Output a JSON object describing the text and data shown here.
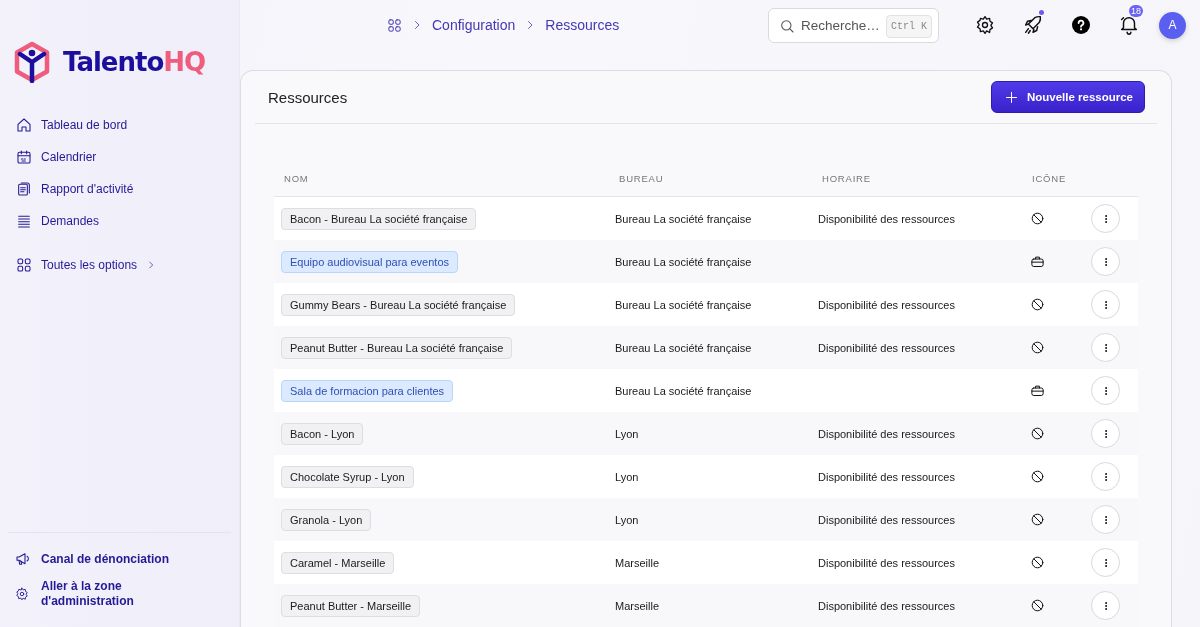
{
  "logo": {
    "text": "Talento",
    "accent": "HQ"
  },
  "sidebar": {
    "items": [
      {
        "label": "Tableau de bord"
      },
      {
        "label": "Calendrier"
      },
      {
        "label": "Rapport d'activité"
      },
      {
        "label": "Demandes"
      }
    ],
    "all_options": "Toutes les options",
    "footer": [
      {
        "label": "Canal de dénonciation"
      },
      {
        "label": "Aller à la zone d'administration"
      }
    ]
  },
  "breadcrumb": [
    "Configuration",
    "Ressources"
  ],
  "search": {
    "placeholder": "Recherche…",
    "shortcut": "Ctrl K"
  },
  "rocket": {
    "unread": true
  },
  "notifications": {
    "count": "18"
  },
  "avatar": "A",
  "page": {
    "title": "Ressources",
    "new_button": "Nouvelle ressource"
  },
  "table": {
    "columns": [
      "NOM",
      "BUREAU",
      "HORAIRE",
      "ICÔNE"
    ],
    "rows": [
      {
        "name": "Bacon - Bureau La société française",
        "kind": "grey",
        "bureau": "Bureau La société française",
        "horaire": "Disponibilité des ressources"
      },
      {
        "name": "Equipo audiovisual para eventos",
        "kind": "blue",
        "bureau": "Bureau La société française"
      },
      {
        "name": "Gummy Bears - Bureau La société française",
        "kind": "grey",
        "bureau": "Bureau La société française",
        "horaire": "Disponibilité des ressources"
      },
      {
        "name": "Peanut Butter - Bureau La société française",
        "kind": "grey",
        "bureau": "Bureau La société française",
        "horaire": "Disponibilité des ressources"
      },
      {
        "name": "Sala de formacion para clientes",
        "kind": "blue",
        "bureau": "Bureau La société française"
      },
      {
        "name": "Bacon - Lyon",
        "kind": "grey",
        "bureau": "Lyon",
        "horaire": "Disponibilité des ressources"
      },
      {
        "name": "Chocolate Syrup - Lyon",
        "kind": "grey",
        "bureau": "Lyon",
        "horaire": "Disponibilité des ressources"
      },
      {
        "name": "Granola - Lyon",
        "kind": "grey",
        "bureau": "Lyon",
        "horaire": "Disponibilité des ressources"
      },
      {
        "name": "Caramel - Marseille",
        "kind": "grey",
        "bureau": "Marseille",
        "horaire": "Disponibilité des ressources"
      },
      {
        "name": "Peanut Butter - Marseille",
        "kind": "grey",
        "bureau": "Marseille",
        "horaire": "Disponibilité des ressources"
      }
    ]
  }
}
